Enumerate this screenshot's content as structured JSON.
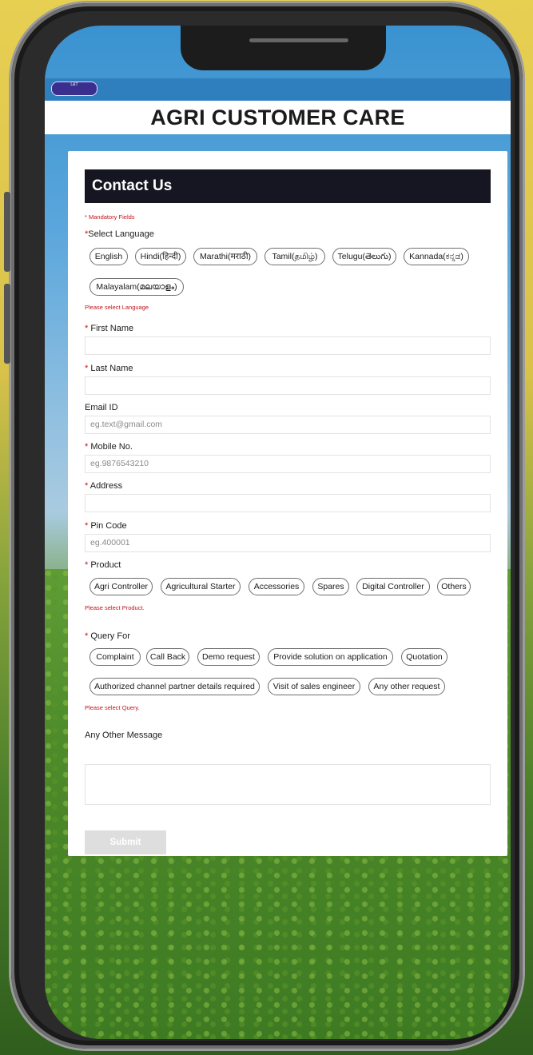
{
  "header": {
    "logo_text": "Larsen & Toubro",
    "title": "AGRI CUSTOMER CARE"
  },
  "form": {
    "heading": "Contact Us",
    "mandatory_note": "* Mandatory Fields",
    "language": {
      "label": "Select Language",
      "options": [
        "English",
        "Hindi(हिन्दी)",
        "Marathi(मराठी)",
        "Tamil(தமிழ்)",
        "Telugu(తెలుగు)",
        "Kannada(ಕನ್ನಡ)",
        "Malayalam(മലയാളം)"
      ],
      "error": "Please select Language"
    },
    "first_name": {
      "label": "First Name",
      "value": ""
    },
    "last_name": {
      "label": "Last Name",
      "value": ""
    },
    "email": {
      "label": "Email ID",
      "placeholder": "eg.text@gmail.com"
    },
    "mobile": {
      "label": "Mobile No.",
      "placeholder": "eg.9876543210"
    },
    "address": {
      "label": "Address",
      "value": ""
    },
    "pincode": {
      "label": "Pin Code",
      "placeholder": "eg.400001"
    },
    "product": {
      "label": "Product",
      "options": [
        "Agri Controller",
        "Agricultural Starter",
        "Accessories",
        "Spares",
        "Digital Controller",
        "Others"
      ],
      "error": "Please select Product."
    },
    "query": {
      "label": "Query For",
      "options": [
        "Complaint",
        "Call Back",
        "Demo request",
        "Provide solution on application",
        "Quotation",
        "Authorized channel partner details required",
        "Visit of sales engineer",
        "Any other request"
      ],
      "error": "Please select Query."
    },
    "message": {
      "label": "Any Other Message",
      "value": ""
    },
    "submit_label": "Submit"
  },
  "colors": {
    "header_bg": "#161622",
    "error_red": "#c0141b",
    "topbar_blue": "#2f7fbf"
  }
}
